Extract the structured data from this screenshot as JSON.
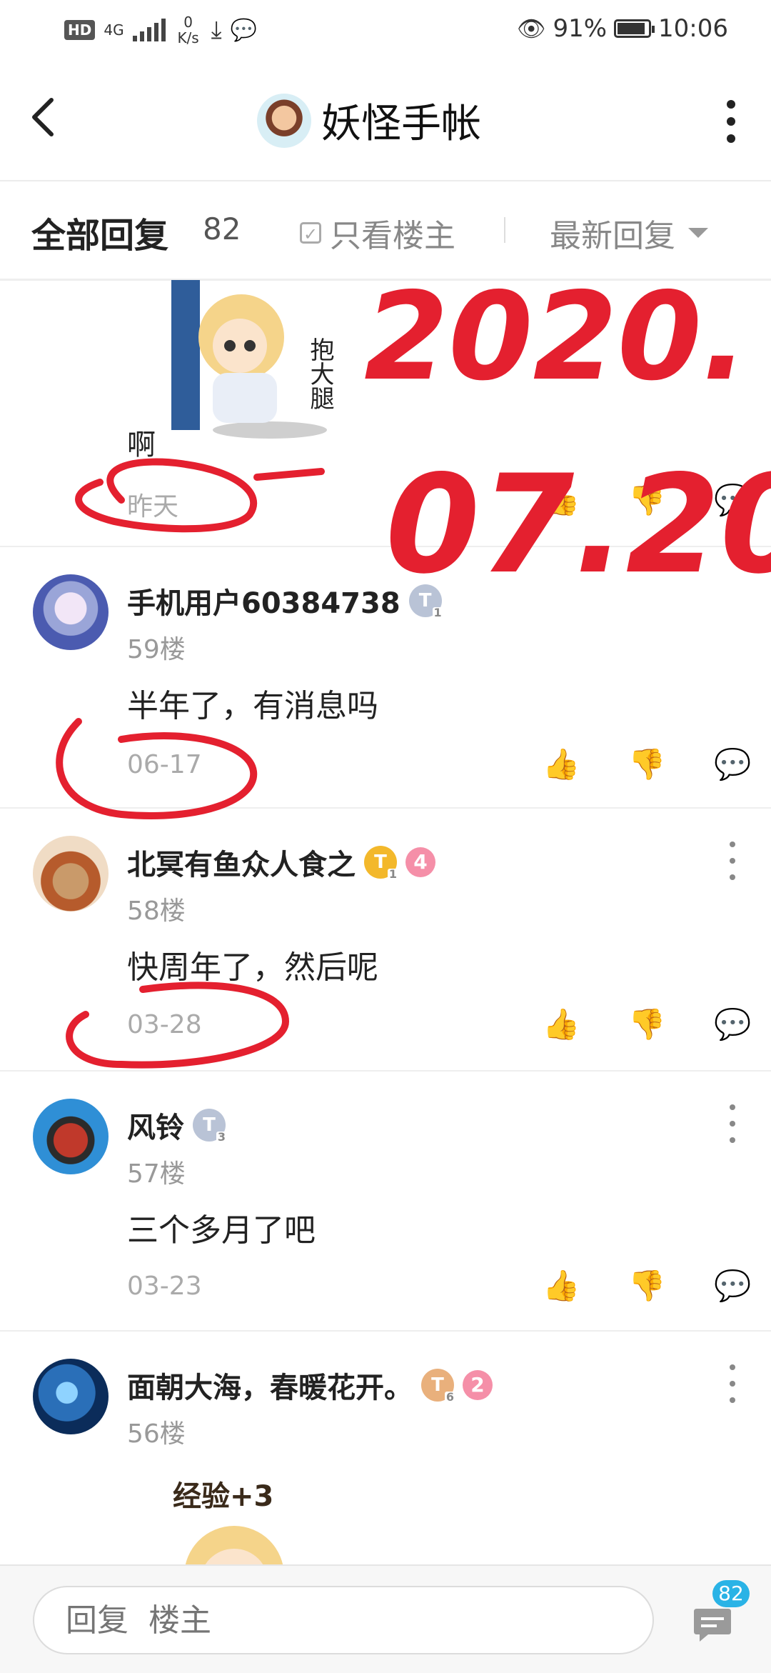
{
  "status_bar": {
    "hd": "HD",
    "network": "4G",
    "speed_value": "0",
    "speed_unit": "K/s",
    "battery": "91%",
    "battery_level": 0.91,
    "time": "10:06"
  },
  "nav": {
    "title": "妖怪手帐"
  },
  "filter": {
    "all_replies": "全部回复",
    "reply_count": "82",
    "only_host": "只看楼主",
    "sort": "最新回复"
  },
  "first_reply": {
    "text": "啊",
    "sticker_text": "抱大腿",
    "date": "昨天"
  },
  "replies": [
    {
      "user": "手机用户60384738",
      "badge": "T",
      "badge_level": "1",
      "floor": "59楼",
      "content": "半年了，有消息吗",
      "date": "06-17"
    },
    {
      "user": "北冥有鱼众人食之",
      "badge": "T",
      "badge_level": "1",
      "level": "4",
      "floor": "58楼",
      "content": "快周年了，然后呢",
      "date": "03-28"
    },
    {
      "user": "风铃",
      "badge": "T",
      "badge_level": "3",
      "floor": "57楼",
      "content": "三个多月了吧",
      "date": "03-23"
    },
    {
      "user": "面朝大海，春暖花开。",
      "badge": "T",
      "badge_level": "6",
      "level": "2",
      "floor": "56楼",
      "sticker_text": "经验+3"
    }
  ],
  "annotation": {
    "line1": "2020.",
    "line2": "07.20"
  },
  "bottom": {
    "placeholder": "回复  楼主",
    "comment_count": "82"
  },
  "colors": {
    "annotation_red": "#e4202f",
    "badge_silver": "#b9c3d6",
    "badge_gold": "#f3b82b",
    "badge_bronze": "#e9b07c",
    "level_pink": "#f58fa8",
    "count_blue": "#2ab3e6"
  }
}
